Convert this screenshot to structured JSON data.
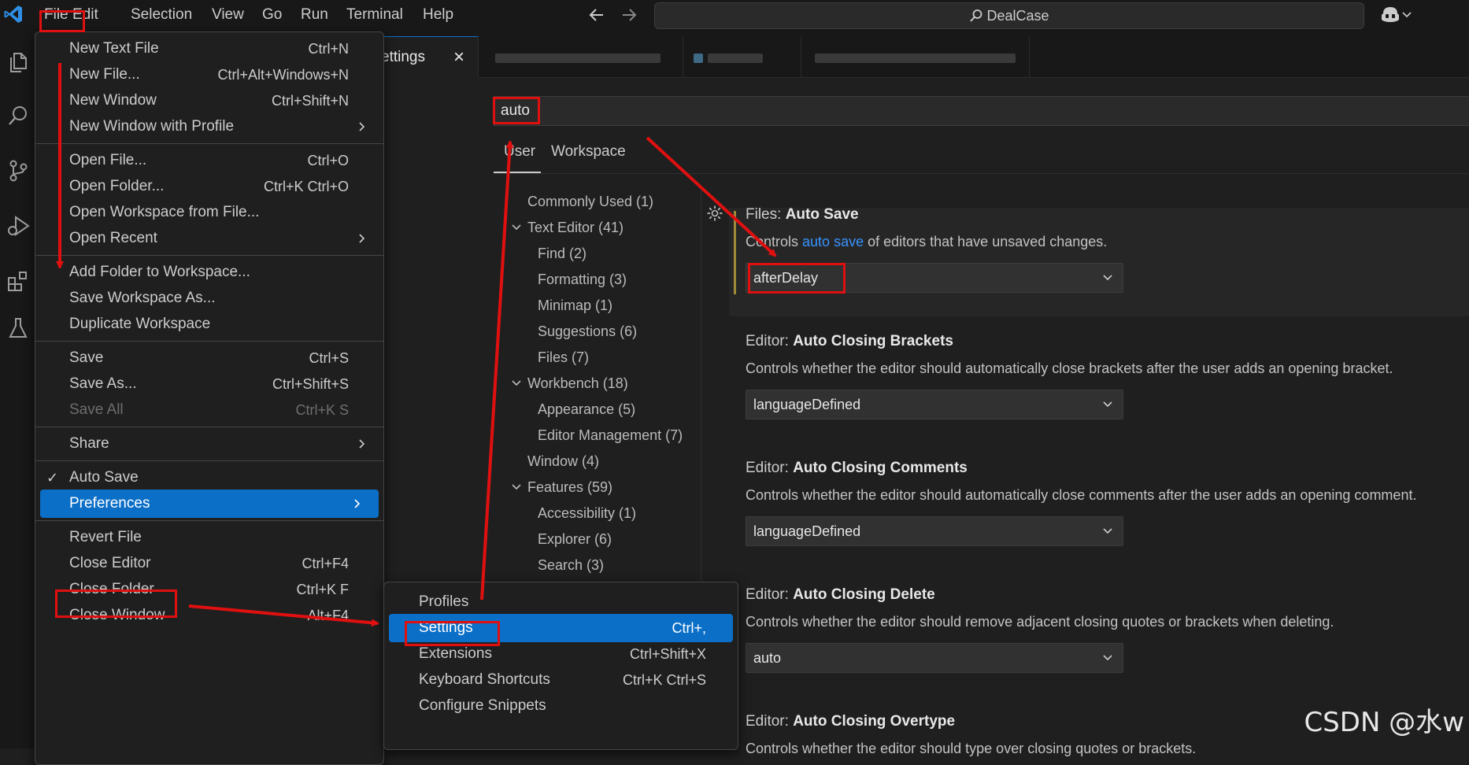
{
  "titlebar": {
    "menus": [
      "File",
      "Edit",
      "Selection",
      "View",
      "Go",
      "Run",
      "Terminal",
      "Help"
    ],
    "search_text": "DealCase",
    "icons": [
      "vscode-logo-icon",
      "back-arrow-icon",
      "forward-arrow-icon",
      "search-icon",
      "copilot-icon",
      "chevron-down-icon"
    ]
  },
  "activitybar": {
    "icons": [
      "explorer-icon",
      "search-icon",
      "source-control-icon",
      "run-debug-icon",
      "extensions-icon",
      "testing-icon"
    ]
  },
  "tabs": {
    "active_label": "ettings",
    "close": "×"
  },
  "settings": {
    "search_value": "auto",
    "scopes": [
      "User",
      "Workspace"
    ],
    "toc": [
      {
        "label": "Commonly Used (1)",
        "indent": 0,
        "chevron": false
      },
      {
        "label": "Text Editor (41)",
        "indent": 0,
        "chevron": true
      },
      {
        "label": "Find (2)",
        "indent": 1,
        "chevron": false
      },
      {
        "label": "Formatting (3)",
        "indent": 1,
        "chevron": false
      },
      {
        "label": "Minimap (1)",
        "indent": 1,
        "chevron": false
      },
      {
        "label": "Suggestions (6)",
        "indent": 1,
        "chevron": false
      },
      {
        "label": "Files (7)",
        "indent": 1,
        "chevron": false
      },
      {
        "label": "Workbench (18)",
        "indent": 0,
        "chevron": true
      },
      {
        "label": "Appearance (5)",
        "indent": 1,
        "chevron": false
      },
      {
        "label": "Editor Management (7)",
        "indent": 1,
        "chevron": false
      },
      {
        "label": "Window (4)",
        "indent": 0,
        "chevron": false
      },
      {
        "label": "Features (59)",
        "indent": 0,
        "chevron": true
      },
      {
        "label": "Accessibility (1)",
        "indent": 1,
        "chevron": false
      },
      {
        "label": "Explorer (6)",
        "indent": 1,
        "chevron": false
      },
      {
        "label": "Search (3)",
        "indent": 1,
        "chevron": false
      }
    ],
    "items": [
      {
        "prefix": "Files: ",
        "name": "Auto Save",
        "desc_pre": "Controls ",
        "desc_link": "auto save",
        "desc_post": " of editors that have unsaved changes.",
        "value": "afterDelay"
      },
      {
        "prefix": "Editor: ",
        "name": "Auto Closing Brackets",
        "desc_pre": "Controls whether the editor should automatically close brackets after the user adds an opening bracket.",
        "desc_link": "",
        "desc_post": "",
        "value": "languageDefined"
      },
      {
        "prefix": "Editor: ",
        "name": "Auto Closing Comments",
        "desc_pre": "Controls whether the editor should automatically close comments after the user adds an opening comment.",
        "desc_link": "",
        "desc_post": "",
        "value": "languageDefined"
      },
      {
        "prefix": "Editor: ",
        "name": "Auto Closing Delete",
        "desc_pre": "Controls whether the editor should remove adjacent closing quotes or brackets when deleting.",
        "desc_link": "",
        "desc_post": "",
        "value": "auto"
      },
      {
        "prefix": "Editor: ",
        "name": "Auto Closing Overtype",
        "desc_pre": "Controls whether the editor should type over closing quotes or brackets.",
        "desc_link": "",
        "desc_post": "",
        "value": ""
      }
    ]
  },
  "file_menu": {
    "items": [
      {
        "label": "New Text File",
        "kb": "Ctrl+N"
      },
      {
        "label": "New File...",
        "kb": "Ctrl+Alt+Windows+N"
      },
      {
        "label": "New Window",
        "kb": "Ctrl+Shift+N"
      },
      {
        "label": "New Window with Profile",
        "kb": "",
        "submenu": true
      },
      {
        "sep": true
      },
      {
        "label": "Open File...",
        "kb": "Ctrl+O"
      },
      {
        "label": "Open Folder...",
        "kb": "Ctrl+K Ctrl+O"
      },
      {
        "label": "Open Workspace from File...",
        "kb": ""
      },
      {
        "label": "Open Recent",
        "kb": "",
        "submenu": true
      },
      {
        "sep": true
      },
      {
        "label": "Add Folder to Workspace...",
        "kb": ""
      },
      {
        "label": "Save Workspace As...",
        "kb": ""
      },
      {
        "label": "Duplicate Workspace",
        "kb": ""
      },
      {
        "sep": true
      },
      {
        "label": "Save",
        "kb": "Ctrl+S"
      },
      {
        "label": "Save As...",
        "kb": "Ctrl+Shift+S"
      },
      {
        "label": "Save All",
        "kb": "Ctrl+K S",
        "disabled": true
      },
      {
        "sep": true
      },
      {
        "label": "Share",
        "kb": "",
        "submenu": true
      },
      {
        "sep": true
      },
      {
        "label": "Auto Save",
        "kb": "",
        "checked": true
      },
      {
        "label": "Preferences",
        "kb": "",
        "submenu": true,
        "selected": true
      },
      {
        "sep": true
      },
      {
        "label": "Revert File",
        "kb": ""
      },
      {
        "label": "Close Editor",
        "kb": "Ctrl+F4"
      },
      {
        "label": "Close Folder",
        "kb": "Ctrl+K F"
      },
      {
        "label": "Close Window",
        "kb": "Alt+F4"
      }
    ]
  },
  "preferences_menu": {
    "items": [
      {
        "label": "Profiles",
        "kb": ""
      },
      {
        "label": "Settings",
        "kb": "Ctrl+,",
        "selected": true
      },
      {
        "label": "Extensions",
        "kb": "Ctrl+Shift+X"
      },
      {
        "label": "Keyboard Shortcuts",
        "kb": "Ctrl+K Ctrl+S"
      },
      {
        "label": "Configure Snippets",
        "kb": ""
      }
    ]
  },
  "checkmark": "✓",
  "watermark": "CSDN @水w",
  "colors": {
    "accent": "#0b6fc7",
    "annotation": "#e01010",
    "link": "#3794ff"
  }
}
